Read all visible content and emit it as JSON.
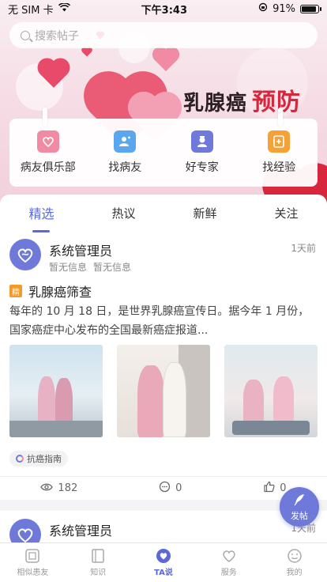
{
  "status_bar": {
    "carrier": "无 SIM 卡",
    "time": "下午3:43",
    "battery": "91%"
  },
  "search": {
    "placeholder": "搜索帖子"
  },
  "banner": {
    "title_dark": "乳腺癌",
    "title_red": "预防"
  },
  "quick_menu": [
    {
      "label": "病友俱乐部",
      "icon": "club-icon",
      "color": "#f18aa3"
    },
    {
      "label": "找病友",
      "icon": "find-patient-icon",
      "color": "#5aa7ef"
    },
    {
      "label": "好专家",
      "icon": "expert-icon",
      "color": "#6f79d9"
    },
    {
      "label": "找经验",
      "icon": "experience-icon",
      "color": "#f5a135"
    }
  ],
  "tabs": [
    {
      "label": "精选",
      "active": true
    },
    {
      "label": "热议"
    },
    {
      "label": "新鲜"
    },
    {
      "label": "关注"
    }
  ],
  "posts": [
    {
      "author": "系统管理员",
      "meta1": "暂无信息",
      "meta2": "暂无信息",
      "time": "1天前",
      "badge": "精",
      "title": "乳腺癌筛查",
      "summary": "每年的 10 月 18 日，是世界乳腺癌宣传日。据今年 1 月份，国家癌症中心发布的全国最新癌症报道...",
      "tag": "抗癌指南",
      "views": "182",
      "comments": "0",
      "likes": "0"
    },
    {
      "author": "系统管理员",
      "time": "1天前"
    }
  ],
  "fab": {
    "label": "发帖"
  },
  "bottom_nav": [
    {
      "label": "相似患友",
      "icon": "similar-patient-icon"
    },
    {
      "label": "知识",
      "icon": "book-icon"
    },
    {
      "label": "TA说",
      "icon": "heart-chat-icon",
      "active": true
    },
    {
      "label": "服务",
      "icon": "heart-outline-icon"
    },
    {
      "label": "我的",
      "icon": "smiley-icon"
    }
  ]
}
